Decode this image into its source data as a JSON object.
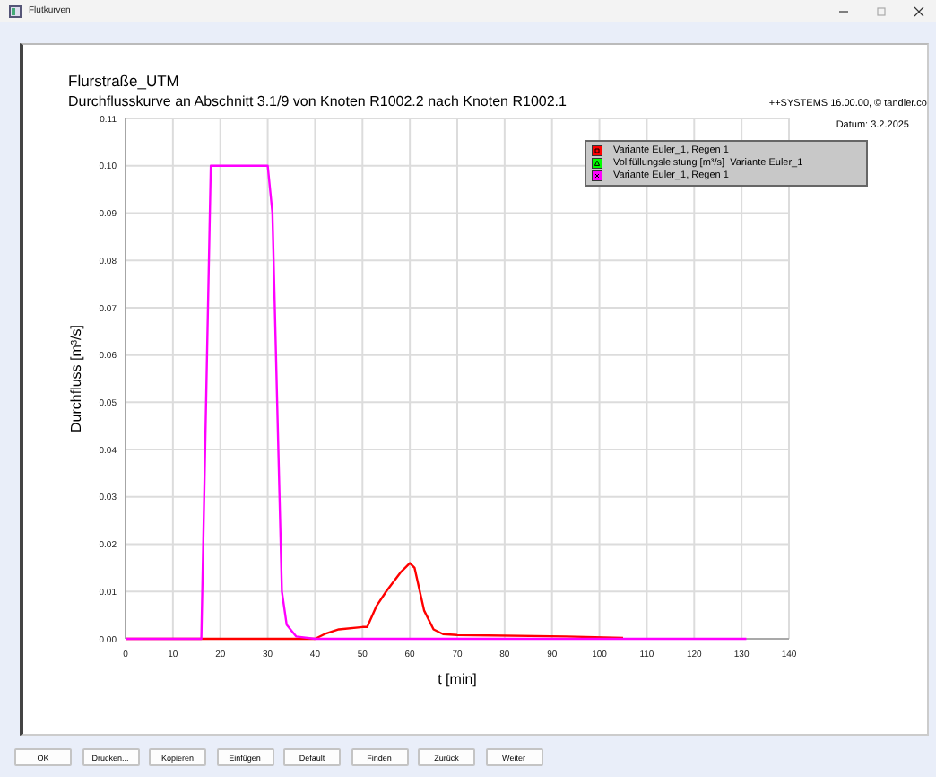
{
  "window": {
    "title": "Flutkurven"
  },
  "chart": {
    "title": "Flurstraße_UTM",
    "subtitle": "Durchflusskurve an Abschnitt 3.1/9 von Knoten R1002.2 nach Knoten R1002.1",
    "credit": "++SYSTEMS 16.00.00, © tandler.co",
    "date": "Datum: 3.2.2025",
    "legend": [
      {
        "kind": "square"
      },
      {
        "kind": "triangle"
      },
      {
        "kind": "cross"
      }
    ],
    "chart_data": {
      "type": "line",
      "xlabel": "t [min]",
      "ylabel": "Durchfluss [m³/s]",
      "x": [
        0,
        16,
        17,
        18,
        30,
        31,
        32,
        33,
        34,
        36,
        40,
        42,
        45,
        50,
        51,
        53,
        55,
        58,
        60,
        61,
        63,
        65,
        67,
        70,
        93,
        105,
        131
      ],
      "series": [
        {
          "name": "Variante Euler_1, Regen 1",
          "color": "#ff0000",
          "values": [
            0,
            0,
            0,
            0,
            0,
            0,
            0,
            0,
            0,
            0,
            0,
            0.001,
            0.002,
            0.0025,
            0.0025,
            0.007,
            0.01,
            0.014,
            0.016,
            0.015,
            0.006,
            0.002,
            0.001,
            0.0008,
            0.0005,
            0.0002,
            null
          ]
        },
        {
          "name": "Vollfüllungsleistung [m³/s]  Variante Euler_1",
          "color": "#00ff00",
          "values": [
            null,
            null,
            null,
            null,
            null,
            null,
            null,
            null,
            null,
            null,
            null,
            null,
            null,
            null,
            null,
            null,
            null,
            null,
            null,
            null,
            null,
            null,
            null,
            null,
            null,
            null,
            null
          ]
        },
        {
          "name": "Variante Euler_1, Regen 1",
          "color": "#ff00ff",
          "values": [
            0,
            0,
            0.05,
            0.1,
            0.1,
            0.09,
            0.05,
            0.01,
            0.003,
            0.0005,
            0,
            0,
            0,
            0,
            0,
            0,
            0,
            0,
            0,
            0,
            0,
            0,
            0,
            0,
            0,
            0,
            0
          ]
        }
      ],
      "grid": true,
      "xlim": [
        0,
        140
      ],
      "ylim": [
        0,
        0.11
      ],
      "xticks": [
        0,
        10,
        20,
        30,
        40,
        50,
        60,
        70,
        80,
        90,
        100,
        110,
        120,
        130,
        140
      ],
      "yticks": [
        {
          "value": 0,
          "label": "0.00"
        },
        {
          "value": 0.01,
          "label": "0.01"
        },
        {
          "value": 0.02,
          "label": "0.02"
        },
        {
          "value": 0.03,
          "label": "0.03"
        },
        {
          "value": 0.04,
          "label": "0.04"
        },
        {
          "value": 0.05,
          "label": "0.05"
        },
        {
          "value": 0.06,
          "label": "0.06"
        },
        {
          "value": 0.07,
          "label": "0.07"
        },
        {
          "value": 0.08,
          "label": "0.08"
        },
        {
          "value": 0.09,
          "label": "0.09"
        },
        {
          "value": 0.1,
          "label": "0.10"
        },
        {
          "value": 0.11,
          "label": "0.11"
        }
      ]
    }
  },
  "buttons": [
    "OK",
    "Drucken...",
    "Kopieren",
    "Einfügen",
    "Default",
    "Finden",
    "Zurück",
    "Weiter"
  ]
}
